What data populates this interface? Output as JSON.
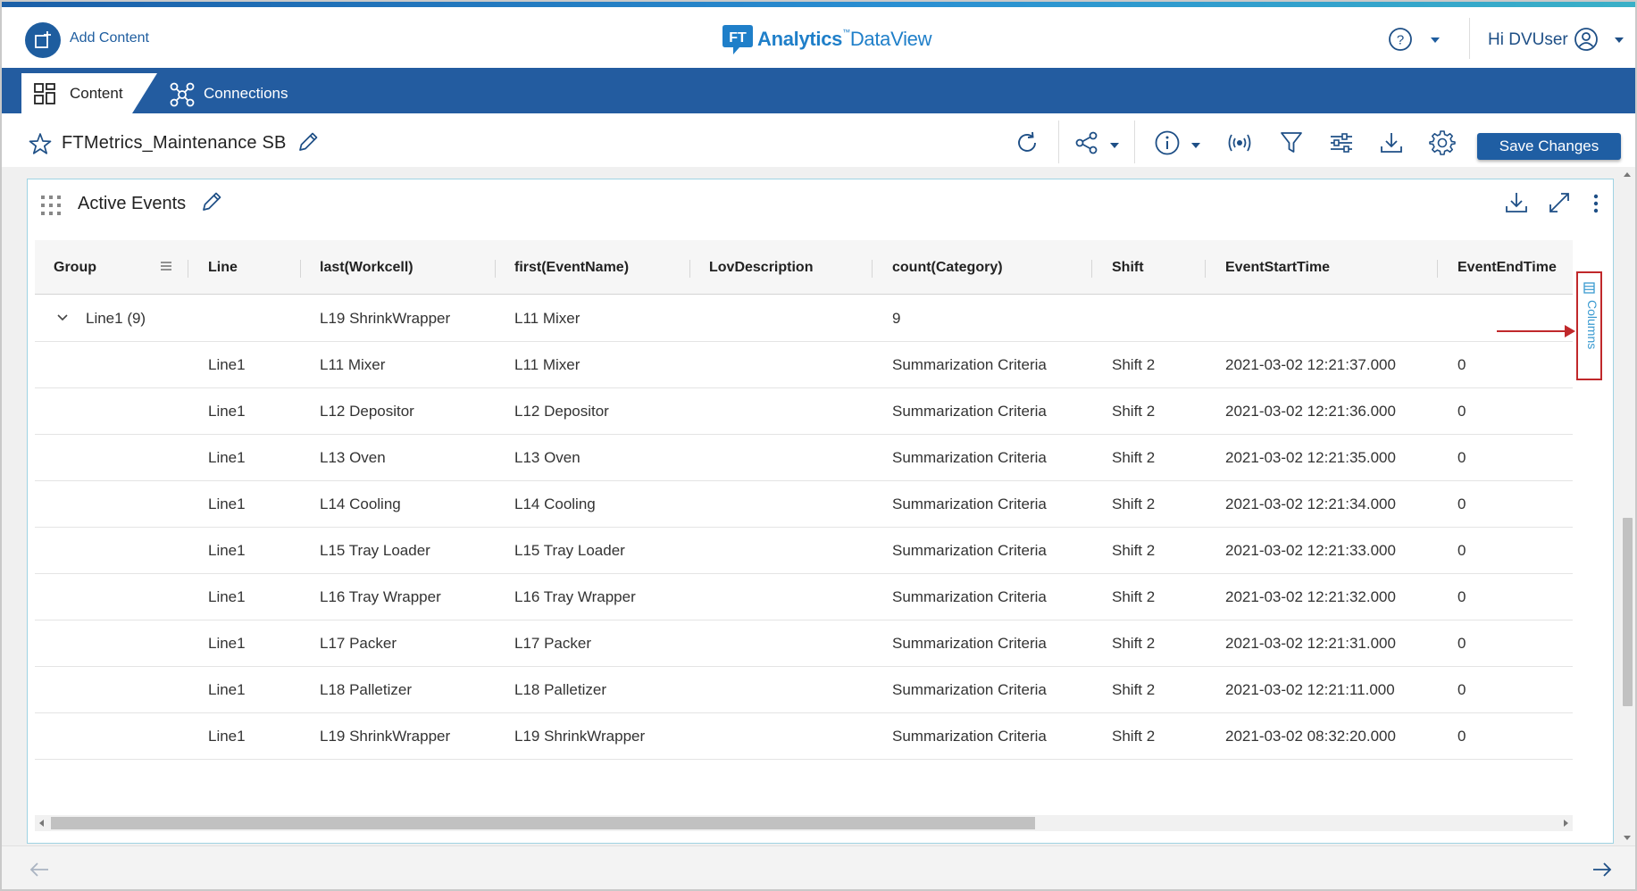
{
  "header": {
    "add_content_label": "Add Content",
    "logo_brand": "Analytics",
    "logo_tm": "™",
    "logo_product": "DataView",
    "user_greeting": "Hi DVUser"
  },
  "nav": {
    "tabs": [
      {
        "label": "Content",
        "active": true
      },
      {
        "label": "Connections",
        "active": false
      }
    ]
  },
  "page": {
    "title": "FTMetrics_Maintenance SB",
    "save_label": "Save Changes"
  },
  "widget": {
    "title": "Active Events",
    "columns_panel_label": "Columns"
  },
  "grid": {
    "columns": [
      "Group",
      "Line",
      "last(Workcell)",
      "first(EventName)",
      "LovDescription",
      "count(Category)",
      "Shift",
      "EventStartTime",
      "EventEndTime"
    ],
    "group_row": {
      "label": "Line1 (9)",
      "workcell": "L19 ShrinkWrapper",
      "event_name": "L11 Mixer",
      "count": "9"
    },
    "rows": [
      {
        "line": "Line1",
        "workcell": "L11 Mixer",
        "event_name": "L11 Mixer",
        "lov": "",
        "category": "Summarization Criteria",
        "shift": "Shift 2",
        "start": "2021-03-02 12:21:37.000",
        "end": "0"
      },
      {
        "line": "Line1",
        "workcell": "L12 Depositor",
        "event_name": "L12 Depositor",
        "lov": "",
        "category": "Summarization Criteria",
        "shift": "Shift 2",
        "start": "2021-03-02 12:21:36.000",
        "end": "0"
      },
      {
        "line": "Line1",
        "workcell": "L13 Oven",
        "event_name": "L13 Oven",
        "lov": "",
        "category": "Summarization Criteria",
        "shift": "Shift 2",
        "start": "2021-03-02 12:21:35.000",
        "end": "0"
      },
      {
        "line": "Line1",
        "workcell": "L14 Cooling",
        "event_name": "L14 Cooling",
        "lov": "",
        "category": "Summarization Criteria",
        "shift": "Shift 2",
        "start": "2021-03-02 12:21:34.000",
        "end": "0"
      },
      {
        "line": "Line1",
        "workcell": "L15 Tray Loader",
        "event_name": "L15 Tray Loader",
        "lov": "",
        "category": "Summarization Criteria",
        "shift": "Shift 2",
        "start": "2021-03-02 12:21:33.000",
        "end": "0"
      },
      {
        "line": "Line1",
        "workcell": "L16 Tray Wrapper",
        "event_name": "L16 Tray Wrapper",
        "lov": "",
        "category": "Summarization Criteria",
        "shift": "Shift 2",
        "start": "2021-03-02 12:21:32.000",
        "end": "0"
      },
      {
        "line": "Line1",
        "workcell": "L17 Packer",
        "event_name": "L17 Packer",
        "lov": "",
        "category": "Summarization Criteria",
        "shift": "Shift 2",
        "start": "2021-03-02 12:21:31.000",
        "end": "0"
      },
      {
        "line": "Line1",
        "workcell": "L18 Palletizer",
        "event_name": "L18 Palletizer",
        "lov": "",
        "category": "Summarization Criteria",
        "shift": "Shift 2",
        "start": "2021-03-02 12:21:11.000",
        "end": "0"
      },
      {
        "line": "Line1",
        "workcell": "L19 ShrinkWrapper",
        "event_name": "L19 ShrinkWrapper",
        "lov": "",
        "category": "Summarization Criteria",
        "shift": "Shift 2",
        "start": "2021-03-02 08:32:20.000",
        "end": "0"
      }
    ]
  },
  "icons": {
    "add_content": "add-content-icon",
    "help": "help-circle-icon",
    "user": "user-circle-icon",
    "content_tab": "dashboard-grid-icon",
    "connections_tab": "network-icon",
    "favorite": "star-icon",
    "edit": "pencil-icon",
    "toolbar": [
      "refresh-icon",
      "share-icon",
      "info-icon",
      "broadcast-icon",
      "filter-icon",
      "sliders-icon",
      "download-icon",
      "gear-icon"
    ],
    "widget": [
      "drag-handle-icon",
      "download-icon",
      "expand-icon",
      "more-vertical-icon"
    ],
    "footer": [
      "arrow-left-icon",
      "arrow-right-icon"
    ]
  },
  "colors": {
    "nav_bg": "#235ca0",
    "brand_blue": "#1e5d9f",
    "logo_blue": "#1f7fc9",
    "highlight_red": "#c0282b",
    "columns_text": "#3a9ad0"
  }
}
